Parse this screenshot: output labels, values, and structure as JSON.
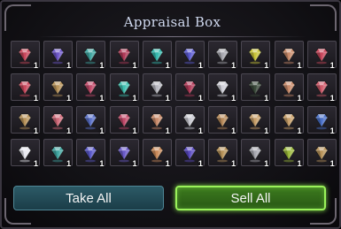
{
  "window": {
    "title": "Appraisal Box"
  },
  "buttons": {
    "take_all": "Take All",
    "sell_all": "Sell All"
  },
  "colors": {
    "title": "#cfd8ee",
    "take_all_bg": "#2c5a66",
    "sell_all_bg": "#3c7a1e",
    "sell_all_glow": "#9af25a"
  },
  "gem_icon": "gem-icon",
  "items": [
    {
      "color": "#c9475c",
      "qty": "1"
    },
    {
      "color": "#6d56c7",
      "qty": "1"
    },
    {
      "color": "#3fa5a0",
      "qty": "1"
    },
    {
      "color": "#b03a58",
      "qty": "1"
    },
    {
      "color": "#35b8ad",
      "qty": "1"
    },
    {
      "color": "#5b5ad0",
      "qty": "1"
    },
    {
      "color": "#a8a8b0",
      "qty": "1"
    },
    {
      "color": "#c8c43a",
      "qty": "1"
    },
    {
      "color": "#c98a6a",
      "qty": "1"
    },
    {
      "color": "#c9475c",
      "qty": "1"
    },
    {
      "color": "#c9475c",
      "qty": "1"
    },
    {
      "color": "#b8935a",
      "qty": "1"
    },
    {
      "color": "#c24a6a",
      "qty": "1"
    },
    {
      "color": "#3fc0b0",
      "qty": "1"
    },
    {
      "color": "#b8b8c0",
      "qty": "1"
    },
    {
      "color": "#b03a58",
      "qty": "1"
    },
    {
      "color": "#d0d0d8",
      "qty": "1"
    },
    {
      "color": "#3a4a3a",
      "qty": "1"
    },
    {
      "color": "#c98a6a",
      "qty": "1"
    },
    {
      "color": "#d05a6a",
      "qty": "1"
    },
    {
      "color": "#b8935a",
      "qty": "1"
    },
    {
      "color": "#d06a7a",
      "qty": "1"
    },
    {
      "color": "#5a70c8",
      "qty": "1"
    },
    {
      "color": "#c24a6a",
      "qty": "1"
    },
    {
      "color": "#c98a6a",
      "qty": "1"
    },
    {
      "color": "#c8c8d0",
      "qty": "1"
    },
    {
      "color": "#b88a5a",
      "qty": "1"
    },
    {
      "color": "#c9a06a",
      "qty": "1"
    },
    {
      "color": "#c9a06a",
      "qty": "1"
    },
    {
      "color": "#4a70c8",
      "qty": "1"
    },
    {
      "color": "#e8e8f0",
      "qty": "1"
    },
    {
      "color": "#3fa5a0",
      "qty": "1"
    },
    {
      "color": "#5a58c8",
      "qty": "1"
    },
    {
      "color": "#6a5ac8",
      "qty": "1"
    },
    {
      "color": "#c98a5a",
      "qty": "1"
    },
    {
      "color": "#5a4ac0",
      "qty": "1"
    },
    {
      "color": "#b8935a",
      "qty": "1"
    },
    {
      "color": "#a8a8b0",
      "qty": "1"
    },
    {
      "color": "#9ab83a",
      "qty": "1"
    },
    {
      "color": "#b8935a",
      "qty": "1"
    }
  ]
}
